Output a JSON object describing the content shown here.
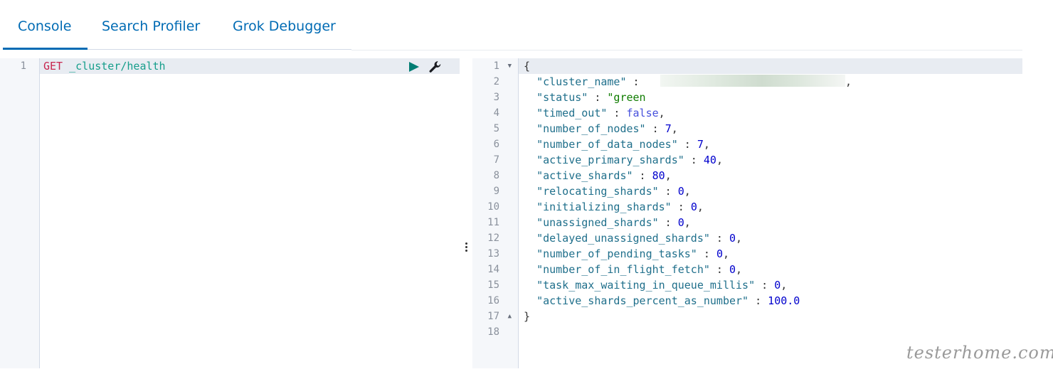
{
  "tabs": [
    {
      "label": "Console",
      "active": true
    },
    {
      "label": "Search Profiler",
      "active": false
    },
    {
      "label": "Grok Debugger",
      "active": false
    }
  ],
  "request": {
    "line_number": "1",
    "method": "GET",
    "path": "_cluster/health"
  },
  "response": {
    "line_numbers": [
      "1",
      "2",
      "3",
      "4",
      "5",
      "6",
      "7",
      "8",
      "9",
      "10",
      "11",
      "12",
      "13",
      "14",
      "15",
      "16",
      "17",
      "18"
    ],
    "open_brace": "{",
    "close_brace": "}",
    "fields": [
      {
        "key": "\"cluster_name\"",
        "value": "",
        "value_type": "redacted"
      },
      {
        "key": "\"status\"",
        "value": "\"green",
        "value_type": "string"
      },
      {
        "key": "\"timed_out\"",
        "value": "false",
        "value_type": "bool"
      },
      {
        "key": "\"number_of_nodes\"",
        "value": "7",
        "value_type": "number"
      },
      {
        "key": "\"number_of_data_nodes\"",
        "value": "7",
        "value_type": "number"
      },
      {
        "key": "\"active_primary_shards\"",
        "value": "40",
        "value_type": "number"
      },
      {
        "key": "\"active_shards\"",
        "value": "80",
        "value_type": "number"
      },
      {
        "key": "\"relocating_shards\"",
        "value": "0",
        "value_type": "number"
      },
      {
        "key": "\"initializing_shards\"",
        "value": "0",
        "value_type": "number"
      },
      {
        "key": "\"unassigned_shards\"",
        "value": "0",
        "value_type": "number"
      },
      {
        "key": "\"delayed_unassigned_shards\"",
        "value": "0",
        "value_type": "number"
      },
      {
        "key": "\"number_of_pending_tasks\"",
        "value": "0",
        "value_type": "number"
      },
      {
        "key": "\"number_of_in_flight_fetch\"",
        "value": "0",
        "value_type": "number"
      },
      {
        "key": "\"task_max_waiting_in_queue_millis\"",
        "value": "0",
        "value_type": "number"
      },
      {
        "key": "\"active_shards_percent_as_number\"",
        "value": "100.0",
        "value_type": "number"
      }
    ]
  },
  "icons": {
    "run": "play-icon",
    "settings": "wrench-icon",
    "resizer": "vertical-dots-icon"
  },
  "colors": {
    "accent": "#006bb4",
    "run_icon": "#017d73",
    "method": "#c7254e",
    "url": "#169e8b",
    "key": "#1f6f8b",
    "string": "#0f7c00",
    "number": "#0000cd",
    "bool": "#4650dc"
  },
  "watermark": "testerhome.com"
}
